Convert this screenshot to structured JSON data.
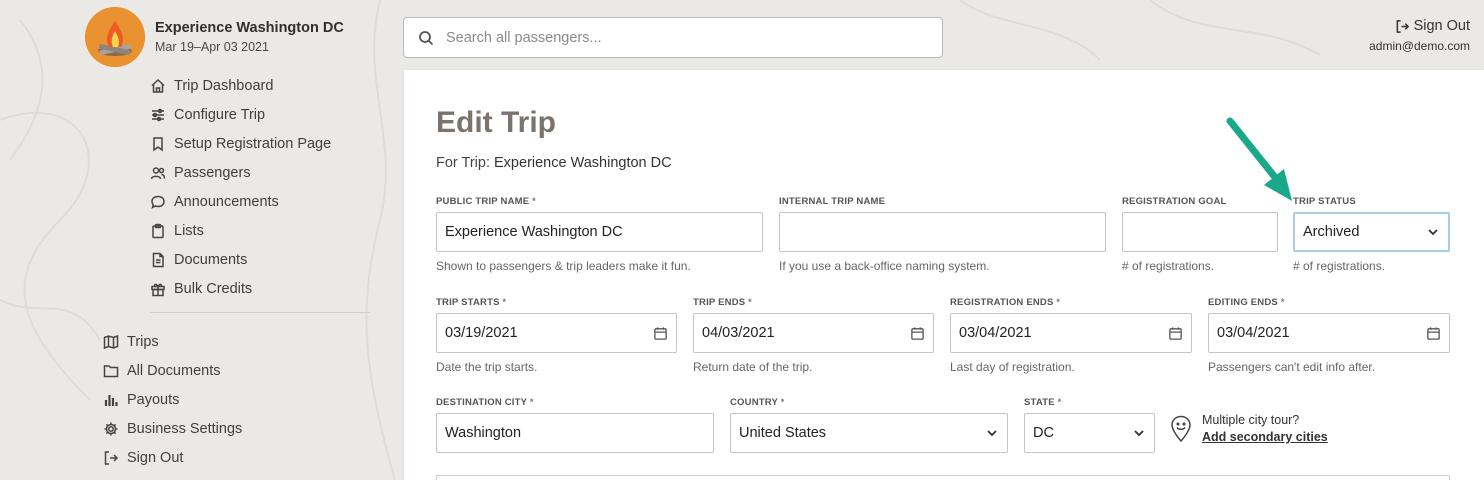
{
  "trip": {
    "name": "Experience Washington DC",
    "dates": "Mar 19–Apr 03 2021"
  },
  "sidebar": {
    "trip_nav": [
      {
        "label": "Trip Dashboard",
        "icon": "home-icon"
      },
      {
        "label": "Configure Trip",
        "icon": "sliders-icon"
      },
      {
        "label": "Setup Registration Page",
        "icon": "bookmark-icon"
      },
      {
        "label": "Passengers",
        "icon": "users-icon"
      },
      {
        "label": "Announcements",
        "icon": "chat-bubble-icon"
      },
      {
        "label": "Lists",
        "icon": "clipboard-icon"
      },
      {
        "label": "Documents",
        "icon": "document-icon"
      },
      {
        "label": "Bulk Credits",
        "icon": "gift-icon"
      }
    ],
    "main_nav": [
      {
        "label": "Trips",
        "icon": "map-icon"
      },
      {
        "label": "All Documents",
        "icon": "folder-icon"
      },
      {
        "label": "Payouts",
        "icon": "bar-chart-icon"
      },
      {
        "label": "Business Settings",
        "icon": "gear-icon"
      },
      {
        "label": "Sign Out",
        "icon": "sign-out-icon"
      }
    ]
  },
  "header": {
    "search_placeholder": "Search all passengers...",
    "sign_out": "Sign Out",
    "user_email": "admin@demo.com"
  },
  "form": {
    "title": "Edit Trip",
    "for_trip_prefix": "For Trip:",
    "for_trip_name": "Experience Washington DC",
    "public_name": {
      "label": "PUBLIC TRIP NAME",
      "value": "Experience Washington DC",
      "help": "Shown to passengers & trip leaders make it fun."
    },
    "internal_name": {
      "label": "INTERNAL TRIP NAME",
      "value": "",
      "help": "If you use a back-office naming system."
    },
    "registration_goal": {
      "label": "REGISTRATION GOAL",
      "value": "",
      "help": "# of registrations."
    },
    "trip_status": {
      "label": "TRIP STATUS",
      "value": "Archived",
      "help": "# of registrations."
    },
    "trip_starts": {
      "label": "TRIP STARTS",
      "value": "03/19/2021",
      "help": "Date the trip starts."
    },
    "trip_ends": {
      "label": "TRIP ENDS",
      "value": "04/03/2021",
      "help": "Return date of the trip."
    },
    "registration_ends": {
      "label": "REGISTRATION ENDS",
      "value": "03/04/2021",
      "help": "Last day of registration."
    },
    "editing_ends": {
      "label": "EDITING ENDS",
      "value": "03/04/2021",
      "help": "Passengers can't edit info after."
    },
    "destination_city": {
      "label": "DESTINATION CITY",
      "value": "Washington"
    },
    "country": {
      "label": "COUNTRY",
      "value": "United States"
    },
    "state": {
      "label": "STATE",
      "value": "DC"
    },
    "multi_city_question": "Multiple city tour?",
    "multi_city_link": "Add secondary cities",
    "required_mark": "*"
  },
  "colors": {
    "background": "#ebe9e6",
    "title": "#7a746c",
    "arrow": "#1aa88a",
    "focus_border": "#a9cbe6"
  }
}
